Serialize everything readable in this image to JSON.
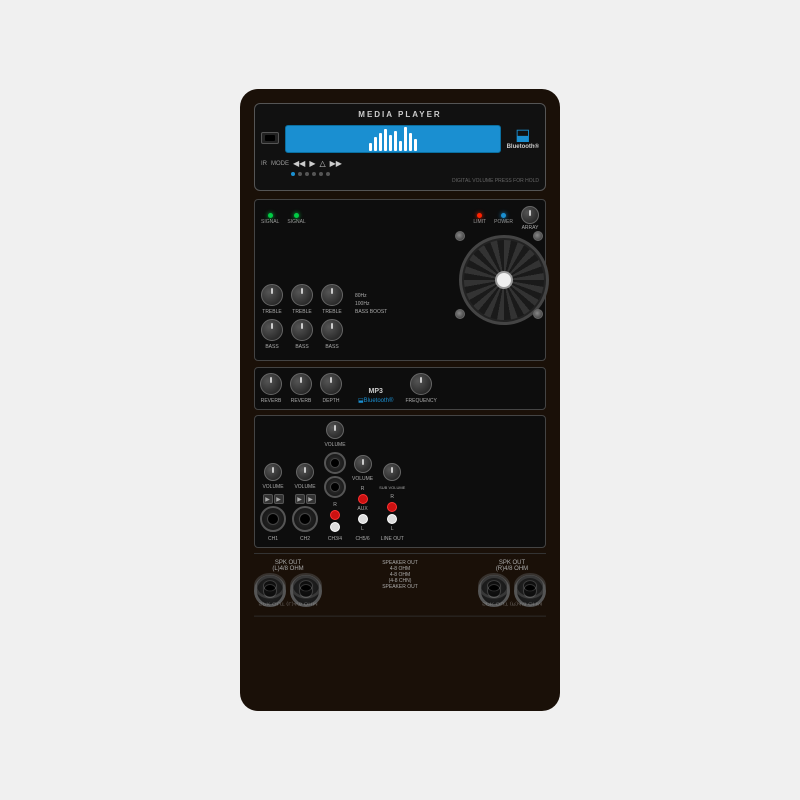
{
  "device": {
    "title": "MEDIA PLAYER",
    "bluetooth_text": "Bluetooth®",
    "usb_label": "USB",
    "ir_label": "IR",
    "mode_label": "MODE",
    "digital_vol_label": "DIGITAL VOLUME PRESS FOR HOLD",
    "channels": {
      "treble_labels": [
        "TREBLE",
        "TREBLE",
        "TREBLE"
      ],
      "bass_labels": [
        "BASS",
        "BASS",
        "BASS"
      ],
      "signal_labels": [
        "SIGNAL",
        "SIGNAL"
      ],
      "reverb_labels": [
        "REVERB",
        "REVERB",
        "DEPTH"
      ],
      "volume_labels": [
        "VOLUME",
        "VOLUME",
        "VOLUME",
        "VOLUME"
      ],
      "ch_labels": [
        "CH1",
        "CH2",
        "CH3/4",
        "CH5/6",
        "LINE OUT"
      ],
      "sub_label": "SUB VOLUME",
      "aux_label": "AUX",
      "limit_label": "LIMIT",
      "power_label": "POWER",
      "array_label": "ARRAY",
      "bass_boost_label": "BASS BOOST",
      "freq_80": "80Hz",
      "freq_100": "100Hz",
      "frequency_label": "FREQUENCY",
      "mp3_label": "MP3",
      "spk_out_left": "SPK OUT\n(L)4/8 OHM",
      "spk_out_right": "SPK OUT\n(R)4/8 OHM",
      "speaker_out_center": "SPEAKER OUT\n4-8 OHM\n4-8 OHM\n(4-8 CHN)\nSPEAKER OUT"
    },
    "colors": {
      "background": "#1a1008",
      "panel": "#111111",
      "accent_blue": "#1a8fd1",
      "led_red": "#ff2200",
      "led_green": "#00cc44",
      "led_blue": "#1a8fd1",
      "knob": "#333333",
      "text": "#aaaaaa"
    }
  }
}
